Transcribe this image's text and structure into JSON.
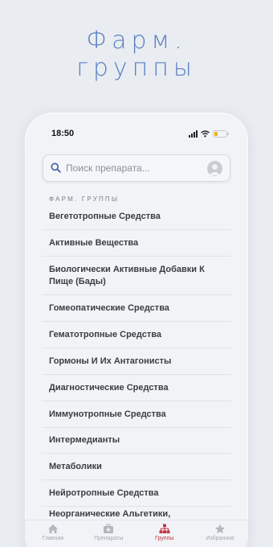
{
  "headline": {
    "line1": "Фарм.",
    "line2": "группы"
  },
  "status": {
    "time": "18:50"
  },
  "search": {
    "placeholder": "Поиск препарата..."
  },
  "section": {
    "title": "ФАРМ. ГРУППЫ"
  },
  "groups": [
    "Вегетотропные Средства",
    "Активные Вещества",
    "Биологически Активные Добавки К Пище (Бады)",
    "Гомеопатические Средства",
    "Гематотропные Средства",
    "Гормоны И Их Антагонисты",
    "Диагностические Средства",
    "Иммунотропные Средства",
    "Интермедианты",
    "Метаболики",
    "Нейротропные Средства",
    "Неорганические Альгетики, Вызывающ..."
  ],
  "tabs": [
    {
      "label": "Главная",
      "icon": "home-icon"
    },
    {
      "label": "Препараты",
      "icon": "medical-kit-icon"
    },
    {
      "label": "Группы",
      "icon": "hierarchy-icon"
    },
    {
      "label": "Избранное",
      "icon": "star-icon"
    }
  ],
  "colors": {
    "accent": "#c43340",
    "headline": "#5b7fc2",
    "background": "#e9edf2"
  }
}
